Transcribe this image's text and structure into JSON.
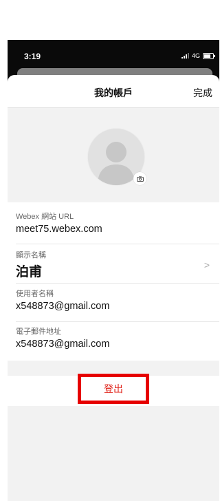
{
  "status_bar": {
    "time": "3:19",
    "network": "4G"
  },
  "header": {
    "title": "我的帳戶",
    "done_label": "完成"
  },
  "fields": [
    {
      "label": "Webex 網站 URL",
      "value": "meet75.webex.com"
    },
    {
      "label": "顯示名稱",
      "value": "泊甫"
    },
    {
      "label": "使用者名稱",
      "value": "x548873@gmail.com"
    },
    {
      "label": "電子郵件地址",
      "value": "x548873@gmail.com"
    }
  ],
  "sign_out": {
    "label": "登出"
  },
  "colors": {
    "sign_out_text": "#e0241b",
    "highlight_border": "#e60000",
    "section_bg": "#f2f2f2"
  }
}
